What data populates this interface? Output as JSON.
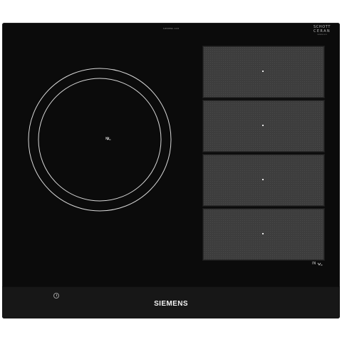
{
  "appliance": {
    "brand": "SIEMENS",
    "top_marking": "SIEMENS 4C8",
    "ceran_logo": {
      "line1": "SCHOTT",
      "line2": "CERAN",
      "line3": "SIEMENS 4C8"
    }
  },
  "zones": {
    "round_zone": {
      "label": "IN"
    },
    "flex_zone": {
      "label": "IN",
      "pad_count": 4
    }
  },
  "controls": {
    "power_icon": "power-icon"
  },
  "colors": {
    "glass": "#0b0b0b",
    "flex_pad": "#3d3d3d",
    "rings": "#d8d8d8",
    "brand": "#f2f2f2"
  }
}
